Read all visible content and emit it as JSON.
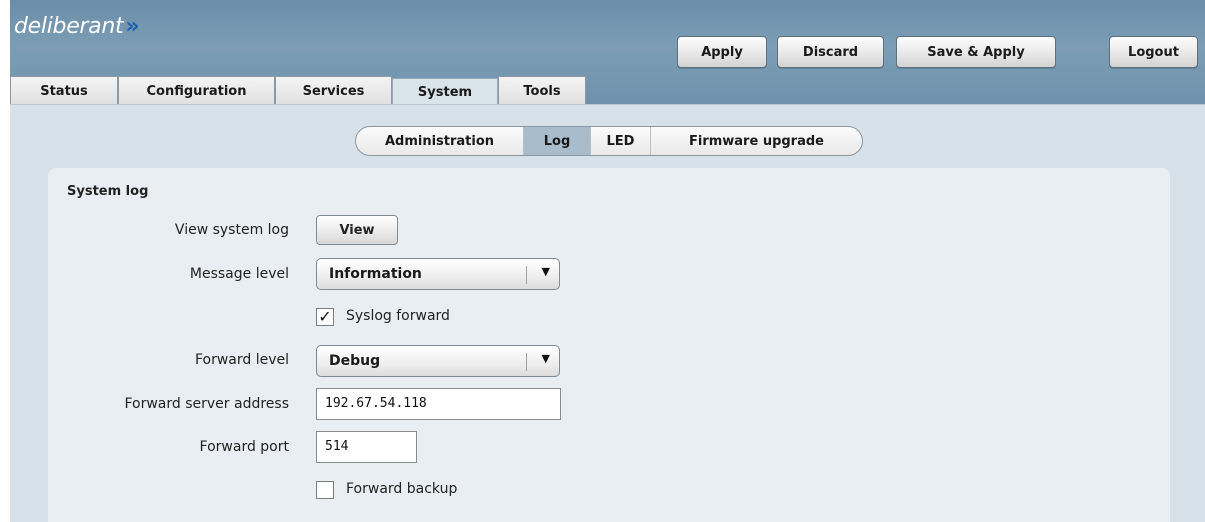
{
  "brand": {
    "name": "deliberant",
    "mark": "»"
  },
  "header_buttons": {
    "apply": "Apply",
    "discard": "Discard",
    "save_apply": "Save & Apply",
    "logout": "Logout"
  },
  "main_tabs": [
    "Status",
    "Configuration",
    "Services",
    "System",
    "Tools"
  ],
  "active_main_tab": "System",
  "sub_tabs": [
    "Administration",
    "Log",
    "LED",
    "Firmware upgrade"
  ],
  "active_sub_tab": "Log",
  "section": {
    "title": "System log",
    "view_log": {
      "label": "View system log",
      "button": "View"
    },
    "message_level": {
      "label": "Message level",
      "value": "Information"
    },
    "syslog_forward": {
      "label": "Syslog forward",
      "checked": true
    },
    "forward_level": {
      "label": "Forward level",
      "value": "Debug"
    },
    "forward_server": {
      "label": "Forward server address",
      "value": "192.67.54.118"
    },
    "forward_port": {
      "label": "Forward port",
      "value": "514"
    },
    "forward_backup": {
      "label": "Forward backup",
      "checked": false
    }
  },
  "icons": {
    "dropdown": "▼",
    "check": "✓"
  }
}
